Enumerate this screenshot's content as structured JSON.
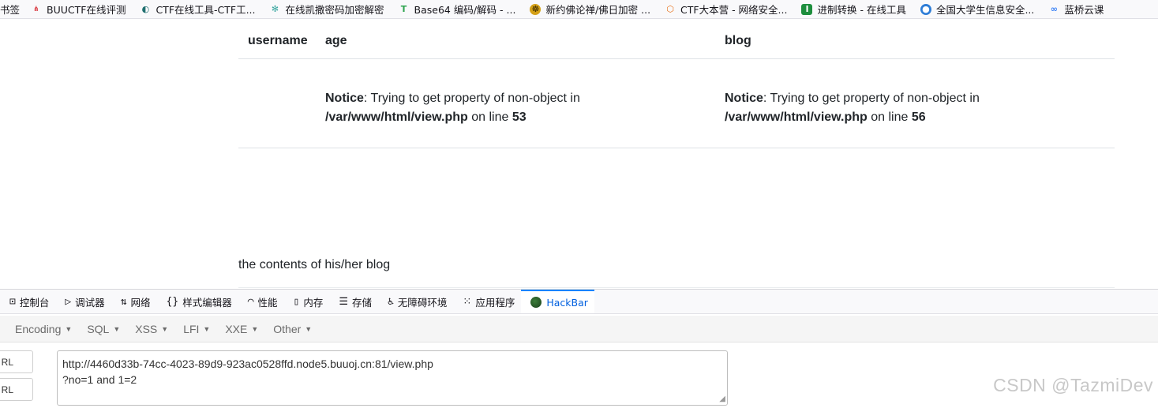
{
  "bookmarks": {
    "folder_label": "书签",
    "items": [
      {
        "label": "BUUCTF在线评测",
        "icon": "buuctf-icon",
        "color": "#d9363e"
      },
      {
        "label": "CTF在线工具-CTF工...",
        "icon": "ctf-tool-icon",
        "color": "#1f6f6f"
      },
      {
        "label": "在线凯撒密码加密解密",
        "icon": "snowflake-icon",
        "color": "#3aa7a0"
      },
      {
        "label": "Base64 编码/解码 - ...",
        "icon": "t-icon",
        "color": "#2ea44f"
      },
      {
        "label": "新约佛论禅/佛日加密 ...",
        "icon": "buddha-icon",
        "color": "#d4a017"
      },
      {
        "label": "CTF大本营 - 网络安全...",
        "icon": "ichunqiu-icon",
        "color": "#e8731f"
      },
      {
        "label": "进制转换 - 在线工具",
        "icon": "convert-icon",
        "color": "#1e8e3e"
      },
      {
        "label": "全国大学生信息安全...",
        "icon": "globe-icon",
        "color": "#2e7dd7"
      },
      {
        "label": "蓝桥云课",
        "icon": "lanqiao-icon",
        "color": "#3b82f6"
      }
    ]
  },
  "table": {
    "headers": [
      "username",
      "age",
      "blog"
    ],
    "age_cell": {
      "notice_label": "Notice",
      "message": ": Trying to get property of non-object in ",
      "path": "/var/www/html/view.php",
      "on_line": " on line ",
      "line": "53"
    },
    "blog_cell": {
      "notice_label": "Notice",
      "message": ": Trying to get property of non-object in ",
      "path": "/var/www/html/view.php",
      "on_line": " on line ",
      "line": "56"
    }
  },
  "blog_contents": "the contents of his/her blog",
  "devtools": {
    "tabs": [
      {
        "label": "控制台",
        "icon": "console-icon"
      },
      {
        "label": "调试器",
        "icon": "debugger-icon"
      },
      {
        "label": "网络",
        "icon": "network-icon"
      },
      {
        "label": "样式编辑器",
        "icon": "style-editor-icon"
      },
      {
        "label": "性能",
        "icon": "performance-icon"
      },
      {
        "label": "内存",
        "icon": "memory-icon"
      },
      {
        "label": "存储",
        "icon": "storage-icon"
      },
      {
        "label": "无障碍环境",
        "icon": "accessibility-icon"
      },
      {
        "label": "应用程序",
        "icon": "application-icon"
      },
      {
        "label": "HackBar",
        "icon": "hackbar-icon",
        "active": true
      }
    ]
  },
  "hackbar": {
    "menus": [
      "Encoding",
      "SQL",
      "XSS",
      "LFI",
      "XXE",
      "Other"
    ],
    "side_buttons": [
      "RL",
      "RL"
    ],
    "url_text": "http://4460d33b-74cc-4023-89d9-923ac0528ffd.node5.buuoj.cn:81/view.php\n?no=1 and 1=2"
  },
  "watermark": "CSDN @TazmiDev",
  "colors": {
    "active_tab": "#0060df",
    "accent": "#0a84ff"
  }
}
